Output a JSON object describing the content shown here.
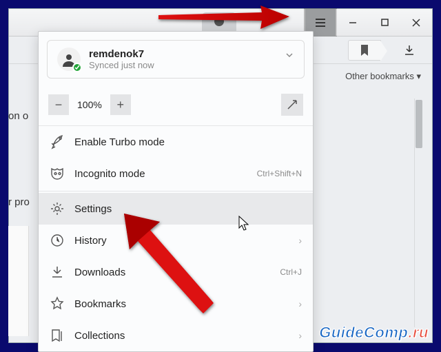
{
  "titlebar": {
    "tab_hint": ""
  },
  "toolbar": {
    "other_bookmarks_label": "Other bookmarks"
  },
  "page": {
    "snippet1": "on o",
    "snippet2": "r pro"
  },
  "menu": {
    "account": {
      "username": "remdenok7",
      "sync_status": "Synced just now"
    },
    "zoom": {
      "minus": "−",
      "value": "100%",
      "plus": "+"
    },
    "items": [
      {
        "key": "turbo",
        "label": "Enable Turbo mode",
        "hint": "",
        "arrow": false
      },
      {
        "key": "incognito",
        "label": "Incognito mode",
        "hint": "Ctrl+Shift+N",
        "arrow": false
      },
      {
        "key": "settings",
        "label": "Settings",
        "hint": "",
        "arrow": false,
        "highlight": true
      },
      {
        "key": "history",
        "label": "History",
        "hint": "",
        "arrow": true
      },
      {
        "key": "downloads",
        "label": "Downloads",
        "hint": "Ctrl+J",
        "arrow": false
      },
      {
        "key": "bookmarks",
        "label": "Bookmarks",
        "hint": "",
        "arrow": true
      },
      {
        "key": "collections",
        "label": "Collections",
        "hint": "",
        "arrow": true
      }
    ]
  },
  "watermark": {
    "name": "GuideComp",
    "tld": ".ru"
  }
}
